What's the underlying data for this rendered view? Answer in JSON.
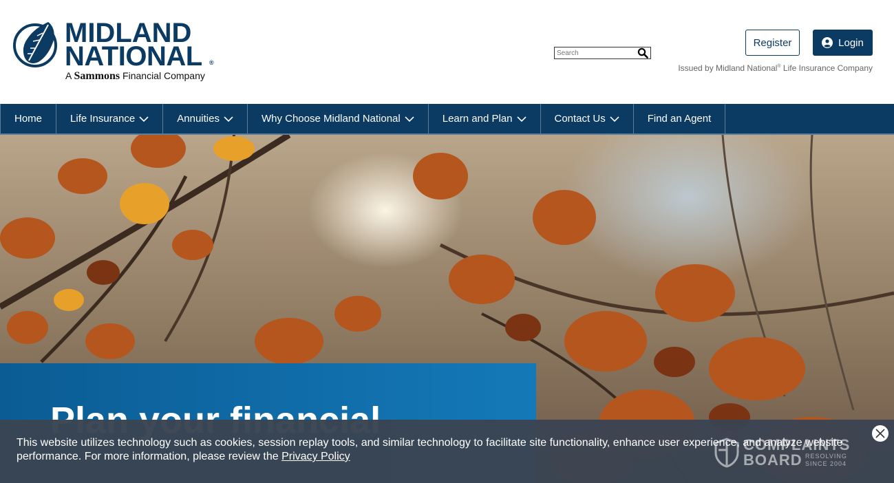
{
  "brand": {
    "name_line1": "MIDLAND",
    "name_line2": "NATIONAL",
    "registered": "®",
    "tagline_prefix": "A ",
    "tagline_bold": "Sammons",
    "tagline_suffix": " Financial Company",
    "color": "#0b3a63"
  },
  "search": {
    "placeholder": "Search",
    "value": ""
  },
  "actions": {
    "register": "Register",
    "login": "Login"
  },
  "issued": {
    "text": "Issued by Midland National",
    "reg": "®",
    "suffix": " Life Insurance Company"
  },
  "nav": {
    "items": [
      {
        "label": "Home",
        "dropdown": false
      },
      {
        "label": "Life Insurance",
        "dropdown": true
      },
      {
        "label": "Annuities",
        "dropdown": true
      },
      {
        "label": "Why Choose Midland National",
        "dropdown": true
      },
      {
        "label": "Learn and Plan",
        "dropdown": true
      },
      {
        "label": "Contact Us",
        "dropdown": true
      },
      {
        "label": "Find an Agent",
        "dropdown": false
      }
    ]
  },
  "hero": {
    "title": "Plan your financial"
  },
  "cookie": {
    "text": "This website utilizes technology such as cookies, session replay tools, and similar technology to facilitate site functionality, enhance user experience, and analyze website performance. For more information, please review the ",
    "link": "Privacy Policy"
  },
  "watermark": {
    "line1": "COMPLAINTS",
    "line2": "BOARD",
    "line3": "RESOLVING",
    "line4": "SINCE 2004"
  }
}
